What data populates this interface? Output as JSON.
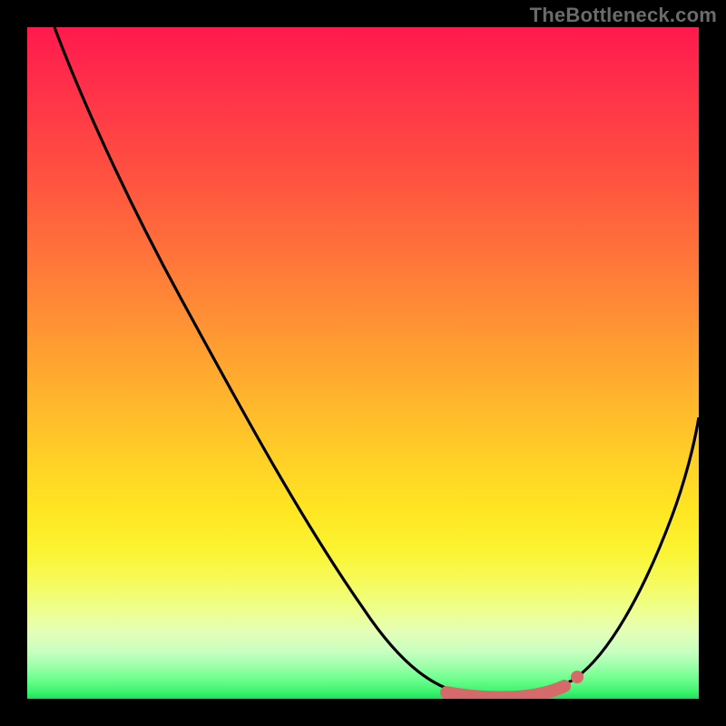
{
  "watermark": "TheBottleneck.com",
  "colors": {
    "frame": "#000000",
    "curve": "#000000",
    "highlight_stroke": "#d66a6a",
    "highlight_fill": "#d66a6a"
  },
  "chart_data": {
    "type": "line",
    "title": "",
    "xlabel": "",
    "ylabel": "",
    "xlim": [
      0,
      100
    ],
    "ylim": [
      0,
      100
    ],
    "grid": false,
    "series": [
      {
        "name": "bottleneck-curve",
        "x": [
          4,
          10,
          20,
          30,
          40,
          50,
          55,
          60,
          64,
          68,
          72,
          76,
          80,
          85,
          90,
          95,
          100
        ],
        "y": [
          100,
          88,
          70,
          53,
          36,
          18,
          10,
          4,
          1,
          0,
          0,
          0,
          2,
          9,
          22,
          38,
          56
        ]
      }
    ],
    "annotations": [
      {
        "name": "optimal-range-highlight",
        "x_start": 63,
        "x_end": 80,
        "style": "thick-rounded-line",
        "color": "#d66a6a"
      },
      {
        "name": "optimal-range-end-dot",
        "x": 80,
        "y": 2,
        "style": "dot",
        "color": "#d66a6a"
      }
    ]
  }
}
